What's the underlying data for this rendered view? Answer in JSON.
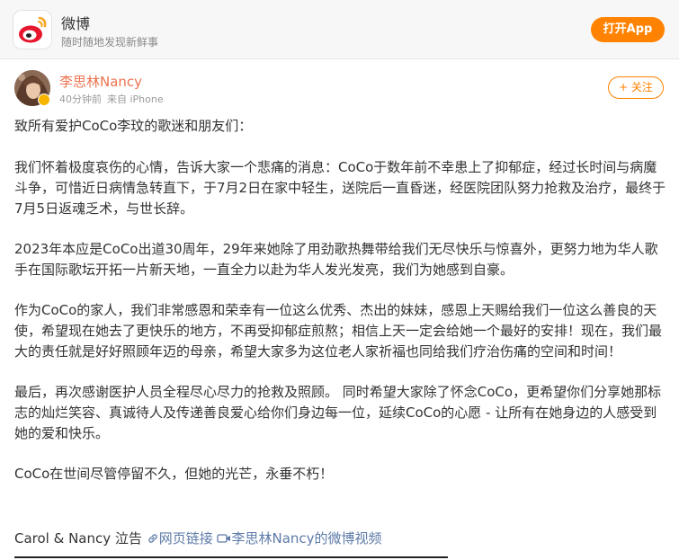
{
  "app_banner": {
    "title": "微博",
    "subtitle": "随时随地发现新鲜事",
    "open_button": "打开App"
  },
  "post": {
    "author": "李思林Nancy",
    "time": "40分钟前",
    "source": "来自 iPhone",
    "follow_button": "+ 关注",
    "paragraphs": [
      "致所有爱护CoCo李玟的歌迷和朋友们：",
      "我们怀着极度哀伤的心情，告诉大家一个悲痛的消息：CoCo于数年前不幸患上了抑郁症，经过长时间与病魔斗争，可惜近日病情急转直下，于7月2日在家中轻生，送院后一直昏迷，经医院团队努力抢救及治疗，最终于7月5日返魂乏术，与世长辞。",
      "2023年本应是CoCo出道30周年，29年来她除了用劲歌热舞带给我们无尽快乐与惊喜外，更努力地为华人歌手在国际歌坛开拓一片新天地，一直全力以赴为华人发光发亮，我们为她感到自豪。",
      "作为CoCo的家人，我们非常感恩和荣幸有一位这么优秀、杰出的妹妹，感恩上天赐给我们一位这么善良的天使，希望现在她去了更快乐的地方，不再受抑郁症煎熬；相信上天一定会给她一个最好的安排！现在，我们最大的责任就是好好照顾年迈的母亲，希望大家多为这位老人家祈福也同给我们疗治伤痛的空间和时间！",
      "最后，再次感谢医护人员全程尽心尽力的抢救及照顾。 同时希望大家除了怀念CoCo，更希望你们分享她那标志的灿烂笑容、真诚待人及传递善良爱心给你们身边每一位，延续CoCo的心愿 - 让所有在她身边的人感受到她的爱和快乐。",
      "CoCo在世间尽管停留不久，但她的光芒，永垂不朽！"
    ],
    "signature": "Carol & Nancy 泣告",
    "link_label": "网页链接",
    "video_label": "李思林Nancy的微博视频"
  },
  "colors": {
    "brand_orange": "#ff8200",
    "author_name": "#eb7350",
    "link": "#5d7aa8"
  },
  "icons": [
    "weibo-logo-icon",
    "verified-badge-icon",
    "link-icon",
    "video-icon"
  ]
}
